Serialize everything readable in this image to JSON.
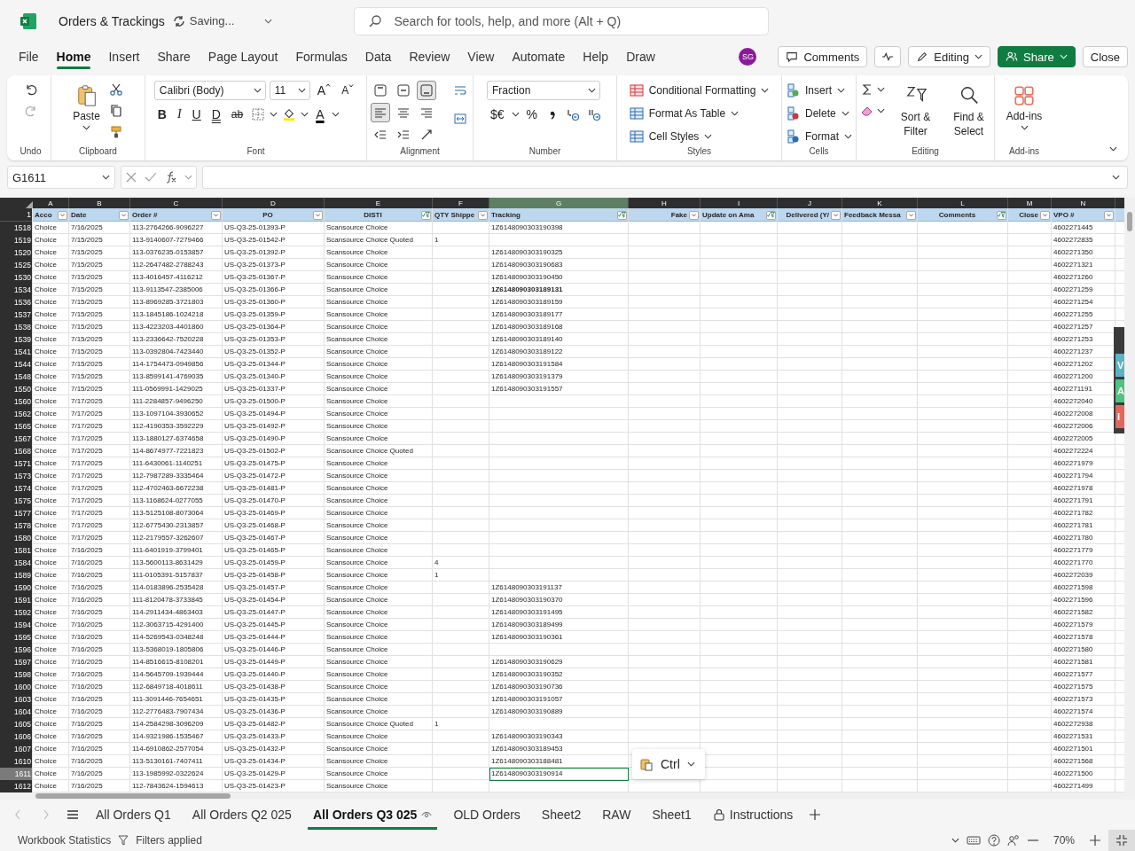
{
  "title_bar": {
    "file_name": "Orders & Trackings",
    "save_status": "Saving...",
    "search_placeholder": "Search for tools, help, and more (Alt + Q)"
  },
  "menu_tabs": [
    {
      "label": "File",
      "selected": false
    },
    {
      "label": "Home",
      "selected": true
    },
    {
      "label": "Insert",
      "selected": false
    },
    {
      "label": "Share",
      "selected": false
    },
    {
      "label": "Page Layout",
      "selected": false
    },
    {
      "label": "Formulas",
      "selected": false
    },
    {
      "label": "Data",
      "selected": false
    },
    {
      "label": "Review",
      "selected": false
    },
    {
      "label": "View",
      "selected": false
    },
    {
      "label": "Automate",
      "selected": false
    },
    {
      "label": "Help",
      "selected": false
    },
    {
      "label": "Draw",
      "selected": false
    }
  ],
  "user_initials": "SG",
  "actions": {
    "comments": "Comments",
    "mode": "Editing",
    "share": "Share",
    "close": "Close"
  },
  "ribbon": {
    "undo": {
      "label": "Undo"
    },
    "clipboard": {
      "paste": "Paste",
      "label": "Clipboard"
    },
    "font": {
      "family": "Calibri (Body)",
      "size": "11",
      "grow": "A",
      "shrink": "A",
      "styles": [
        "B",
        "I",
        "U",
        "D",
        "ab"
      ],
      "color_letter": "A",
      "label": "Font"
    },
    "alignment": {
      "vertical": [
        {
          "selected": false
        },
        {
          "selected": false
        },
        {
          "selected": true
        }
      ],
      "horizontal": [
        {
          "selected": true
        },
        {
          "selected": false
        },
        {
          "selected": false
        }
      ],
      "label": "Alignment"
    },
    "number": {
      "format": "Fraction",
      "currency": "$€",
      "percent": "%",
      "label": "Number"
    },
    "styles": {
      "items": [
        "Conditional Formatting",
        "Format As Table",
        "Cell Styles"
      ],
      "label": "Styles"
    },
    "cells": {
      "items": [
        "Insert",
        "Delete",
        "Format"
      ],
      "label": "Cells"
    },
    "editing": {
      "sort": "Sort & Filter",
      "find": "Find & Select",
      "label": "Editing"
    },
    "addins": {
      "button": "Add-ins",
      "label": "Add-ins"
    }
  },
  "formula_bar": {
    "name_box": "G1611"
  },
  "columns": [
    {
      "letter": "A",
      "header": "Acco",
      "filtered": false,
      "selected": false
    },
    {
      "letter": "B",
      "header": "Date",
      "filtered": false,
      "selected": false
    },
    {
      "letter": "C",
      "header": "Order #",
      "filtered": false,
      "selected": false
    },
    {
      "letter": "D",
      "header": "PO",
      "filtered": false,
      "selected": false
    },
    {
      "letter": "E",
      "header": "DISTI",
      "filtered": true,
      "selected": false
    },
    {
      "letter": "F",
      "header": "QTY Shippe",
      "filtered": false,
      "selected": false
    },
    {
      "letter": "G",
      "header": "Tracking",
      "filtered": true,
      "selected": true
    },
    {
      "letter": "H",
      "header": "Fake",
      "filtered": false,
      "selected": false
    },
    {
      "letter": "I",
      "header": "Update on Ama",
      "filtered": true,
      "selected": false
    },
    {
      "letter": "J",
      "header": "Delivered (Y/",
      "filtered": false,
      "selected": false
    },
    {
      "letter": "K",
      "header": "Feedback Messa",
      "filtered": false,
      "selected": false
    },
    {
      "letter": "L",
      "header": "Comments",
      "filtered": true,
      "selected": false
    },
    {
      "letter": "M",
      "header": "Close",
      "filtered": false,
      "selected": false
    },
    {
      "letter": "N",
      "header": "VPO #",
      "filtered": false,
      "selected": false
    }
  ],
  "header_row_number": "1",
  "rows": [
    {
      "row": "1518",
      "account": "Choice",
      "date": "7/16/2025",
      "order": "113-2764266-9096227",
      "po": "US-Q3-25-01393-P",
      "disti": "Scansource Choice",
      "tracking": "1Z6148090303190398",
      "tracking_bold": false,
      "vpo": "4602271445",
      "selected": false
    },
    {
      "row": "1519",
      "account": "Choice",
      "date": "7/15/2025",
      "order": "113-9140607-7279466",
      "po": "US-Q3-25-01542-P",
      "disti": "Scansource Choice Quoted",
      "qty": "1",
      "vpo": "4602272835",
      "selected": false
    },
    {
      "row": "1520",
      "account": "Choice",
      "date": "7/15/2025",
      "order": "113-0376235-0153857",
      "po": "US-Q3-25-01392-P",
      "disti": "Scansource Choice",
      "tracking": "1Z6148090303190325",
      "tracking_bold": false,
      "vpo": "4602271350",
      "selected": false
    },
    {
      "row": "1525",
      "account": "Choice",
      "date": "7/15/2025",
      "order": "112-2647482-2788243",
      "po": "US-Q3-25-01373-P",
      "disti": "Scansource Choice",
      "tracking": "1Z6148090303190683",
      "tracking_bold": false,
      "vpo": "4602271321",
      "selected": false
    },
    {
      "row": "1530",
      "account": "Choice",
      "date": "7/15/2025",
      "order": "113-4016457-4116212",
      "po": "US-Q3-25-01367-P",
      "disti": "Scansource Choice",
      "tracking": "1Z6148090303190450",
      "tracking_bold": false,
      "vpo": "4602271260",
      "selected": false
    },
    {
      "row": "1534",
      "account": "Choice",
      "date": "7/15/2025",
      "order": "113-9113547-2385006",
      "po": "US-Q3-25-01366-P",
      "disti": "Scansource Choice",
      "tracking": "1Z6148090303189131",
      "tracking_bold": true,
      "vpo": "4602271259",
      "selected": false
    },
    {
      "row": "1536",
      "account": "Choice",
      "date": "7/15/2025",
      "order": "113-8969285-3721803",
      "po": "US-Q3-25-01360-P",
      "disti": "Scansource Choice",
      "tracking": "1Z6148090303189159",
      "tracking_bold": false,
      "vpo": "4602271254",
      "selected": false
    },
    {
      "row": "1537",
      "account": "Choice",
      "date": "7/15/2025",
      "order": "113-1845186-1024218",
      "po": "US-Q3-25-01359-P",
      "disti": "Scansource Choice",
      "tracking": "1Z6148090303189177",
      "tracking_bold": false,
      "vpo": "4602271255",
      "selected": false
    },
    {
      "row": "1538",
      "account": "Choice",
      "date": "7/15/2025",
      "order": "113-4223203-4401860",
      "po": "US-Q3-25-01364-P",
      "disti": "Scansource Choice",
      "tracking": "1Z6148090303189168",
      "tracking_bold": false,
      "vpo": "4602271257",
      "selected": false
    },
    {
      "row": "1539",
      "account": "Choice",
      "date": "7/15/2025",
      "order": "113-2336642-7520228",
      "po": "US-Q3-25-01353-P",
      "disti": "Scansource Choice",
      "tracking": "1Z6148090303189140",
      "tracking_bold": false,
      "vpo": "4602271253",
      "selected": false
    },
    {
      "row": "1541",
      "account": "Choice",
      "date": "7/15/2025",
      "order": "113-0392804-7423440",
      "po": "US-Q3-25-01352-P",
      "disti": "Scansource Choice",
      "tracking": "1Z6148090303189122",
      "tracking_bold": false,
      "vpo": "4602271237",
      "selected": false
    },
    {
      "row": "1544",
      "account": "Choice",
      "date": "7/15/2025",
      "order": "114-1754473-0949856",
      "po": "US-Q3-25-01344-P",
      "disti": "Scansource Choice",
      "tracking": "1Z6148090303191584",
      "tracking_bold": false,
      "vpo": "4602271202",
      "selected": false
    },
    {
      "row": "1548",
      "account": "Choice",
      "date": "7/15/2025",
      "order": "113-8599141-4769035",
      "po": "US-Q3-25-01340-P",
      "disti": "Scansource Choice",
      "tracking": "1Z6148090303191379",
      "tracking_bold": false,
      "vpo": "4602271200",
      "selected": false
    },
    {
      "row": "1550",
      "account": "Choice",
      "date": "7/15/2025",
      "order": "111-0569991-1429025",
      "po": "US-Q3-25-01337-P",
      "disti": "Scansource Choice",
      "tracking": "1Z6148090303191557",
      "tracking_bold": false,
      "vpo": "4602271191",
      "selected": false
    },
    {
      "row": "1560",
      "account": "Choice",
      "date": "7/17/2025",
      "order": "111-2284857-9496250",
      "po": "US-Q3-25-01500-P",
      "disti": "Scansource Choice",
      "vpo": "4602272040",
      "selected": false
    },
    {
      "row": "1562",
      "account": "Choice",
      "date": "7/17/2025",
      "order": "113-1097104-3930652",
      "po": "US-Q3-25-01494-P",
      "disti": "Scansource Choice",
      "vpo": "4602272008",
      "selected": false
    },
    {
      "row": "1565",
      "account": "Choice",
      "date": "7/17/2025",
      "order": "112-4190353-3592229",
      "po": "US-Q3-25-01492-P",
      "disti": "Scansource Choice",
      "vpo": "4602272006",
      "selected": false
    },
    {
      "row": "1567",
      "account": "Choice",
      "date": "7/17/2025",
      "order": "113-1880127-6374658",
      "po": "US-Q3-25-01490-P",
      "disti": "Scansource Choice",
      "vpo": "4602272005",
      "selected": false
    },
    {
      "row": "1568",
      "account": "Choice",
      "date": "7/17/2025",
      "order": "114-8674977-7221823",
      "po": "US-Q3-25-01502-P",
      "disti": "Scansource Choice Quoted",
      "vpo": "4602272224",
      "selected": false
    },
    {
      "row": "1571",
      "account": "Choice",
      "date": "7/17/2025",
      "order": "111-6430061-1140251",
      "po": "US-Q3-25-01475-P",
      "disti": "Scansource Choice",
      "vpo": "4602271979",
      "selected": false
    },
    {
      "row": "1573",
      "account": "Choice",
      "date": "7/17/2025",
      "order": "112-7987289-3335464",
      "po": "US-Q3-25-01472-P",
      "disti": "Scansource Choice",
      "vpo": "4602271794",
      "selected": false
    },
    {
      "row": "1574",
      "account": "Choice",
      "date": "7/17/2025",
      "order": "112-4702463-6672238",
      "po": "US-Q3-25-01481-P",
      "disti": "Scansource Choice",
      "vpo": "4602271978",
      "selected": false
    },
    {
      "row": "1575",
      "account": "Choice",
      "date": "7/17/2025",
      "order": "113-1168624-0277055",
      "po": "US-Q3-25-01470-P",
      "disti": "Scansource Choice",
      "vpo": "4602271791",
      "selected": false
    },
    {
      "row": "1577",
      "account": "Choice",
      "date": "7/17/2025",
      "order": "113-5125108-8073064",
      "po": "US-Q3-25-01469-P",
      "disti": "Scansource Choice",
      "vpo": "4602271782",
      "selected": false
    },
    {
      "row": "1578",
      "account": "Choice",
      "date": "7/17/2025",
      "order": "112-6775430-2313857",
      "po": "US-Q3-25-01468-P",
      "disti": "Scansource Choice",
      "vpo": "4602271781",
      "selected": false
    },
    {
      "row": "1580",
      "account": "Choice",
      "date": "7/17/2025",
      "order": "112-2179557-3262607",
      "po": "US-Q3-25-01467-P",
      "disti": "Scansource Choice",
      "vpo": "4602271780",
      "selected": false
    },
    {
      "row": "1581",
      "account": "Choice",
      "date": "7/16/2025",
      "order": "111-6401919-3799401",
      "po": "US-Q3-25-01465-P",
      "disti": "Scansource Choice",
      "vpo": "4602271779",
      "selected": false
    },
    {
      "row": "1584",
      "account": "Choice",
      "date": "7/16/2025",
      "order": "113-5600113-8631429",
      "po": "US-Q3-25-01459-P",
      "disti": "Scansource Choice",
      "qty": "4",
      "vpo": "4602271770",
      "selected": false
    },
    {
      "row": "1589",
      "account": "Choice",
      "date": "7/16/2025",
      "order": "111-0105391-5157837",
      "po": "US-Q3-25-01458-P",
      "disti": "Scansource Choice",
      "qty": "1",
      "vpo": "4602272039",
      "selected": false
    },
    {
      "row": "1590",
      "account": "Choice",
      "date": "7/16/2025",
      "order": "114-0183896-2535428",
      "po": "US-Q3-25-01457-P",
      "disti": "Scansource Choice",
      "tracking": "1Z6148090303191137",
      "tracking_bold": false,
      "vpo": "4602271598",
      "selected": false
    },
    {
      "row": "1591",
      "account": "Choice",
      "date": "7/16/2025",
      "order": "111-8120478-3733845",
      "po": "US-Q3-25-01454-P",
      "disti": "Scansource Choice",
      "tracking": "1Z6148090303190370",
      "tracking_bold": false,
      "vpo": "4602271596",
      "selected": false
    },
    {
      "row": "1592",
      "account": "Choice",
      "date": "7/16/2025",
      "order": "114-2911434-4863403",
      "po": "US-Q3-25-01447-P",
      "disti": "Scansource Choice",
      "tracking": "1Z6148090303191495",
      "tracking_bold": false,
      "vpo": "4602271582",
      "selected": false
    },
    {
      "row": "1594",
      "account": "Choice",
      "date": "7/16/2025",
      "order": "112-3063715-4291400",
      "po": "US-Q3-25-01445-P",
      "disti": "Scansource Choice",
      "tracking": "1Z6148090303189499",
      "tracking_bold": false,
      "vpo": "4602271579",
      "selected": false
    },
    {
      "row": "1595",
      "account": "Choice",
      "date": "7/16/2025",
      "order": "114-5269543-0348248",
      "po": "US-Q3-25-01444-P",
      "disti": "Scansource Choice",
      "tracking": "1Z6148090303190361",
      "tracking_bold": false,
      "vpo": "4602271578",
      "selected": false
    },
    {
      "row": "1596",
      "account": "Choice",
      "date": "7/16/2025",
      "order": "113-5368019-1805806",
      "po": "US-Q3-25-01446-P",
      "disti": "Scansource Choice",
      "vpo": "4602271580",
      "selected": false
    },
    {
      "row": "1597",
      "account": "Choice",
      "date": "7/16/2025",
      "order": "114-8516615-8108201",
      "po": "US-Q3-25-01449-P",
      "disti": "Scansource Choice",
      "tracking": "1Z6148090303190629",
      "tracking_bold": false,
      "vpo": "4602271581",
      "selected": false
    },
    {
      "row": "1598",
      "account": "Choice",
      "date": "7/16/2025",
      "order": "114-5645709-1939444",
      "po": "US-Q3-25-01440-P",
      "disti": "Scansource Choice",
      "tracking": "1Z6148090303190352",
      "tracking_bold": false,
      "vpo": "4602271577",
      "selected": false
    },
    {
      "row": "1600",
      "account": "Choice",
      "date": "7/16/2025",
      "order": "112-6849718-4018611",
      "po": "US-Q3-25-01438-P",
      "disti": "Scansource Choice",
      "tracking": "1Z6148090303190736",
      "tracking_bold": false,
      "vpo": "4602271575",
      "selected": false
    },
    {
      "row": "1603",
      "account": "Choice",
      "date": "7/16/2025",
      "order": "111-3091446-7654651",
      "po": "US-Q3-25-01435-P",
      "disti": "Scansource Choice",
      "tracking": "1Z6148090303191057",
      "tracking_bold": false,
      "vpo": "4602271573",
      "selected": false
    },
    {
      "row": "1604",
      "account": "Choice",
      "date": "7/16/2025",
      "order": "112-2776483-7907434",
      "po": "US-Q3-25-01436-P",
      "disti": "Scansource Choice",
      "tracking": "1Z6148090303190889",
      "tracking_bold": false,
      "vpo": "4602271574",
      "selected": false
    },
    {
      "row": "1605",
      "account": "Choice",
      "date": "7/16/2025",
      "order": "114-2584298-3096209",
      "po": "US-Q3-25-01482-P",
      "disti": "Scansource Choice Quoted",
      "qty": "1",
      "vpo": "4602272938",
      "selected": false
    },
    {
      "row": "1606",
      "account": "Choice",
      "date": "7/16/2025",
      "order": "114-9321986-1535467",
      "po": "US-Q3-25-01433-P",
      "disti": "Scansource Choice",
      "tracking": "1Z6148090303190343",
      "tracking_bold": false,
      "vpo": "4602271531",
      "selected": false
    },
    {
      "row": "1607",
      "account": "Choice",
      "date": "7/16/2025",
      "order": "114-6910862-2577054",
      "po": "US-Q3-25-01432-P",
      "disti": "Scansource Choice",
      "tracking": "1Z6148090303189453",
      "tracking_bold": false,
      "vpo": "4602271501",
      "selected": false
    },
    {
      "row": "1610",
      "account": "Choice",
      "date": "7/16/2025",
      "order": "113-5130161-7407411",
      "po": "US-Q3-25-01434-P",
      "disti": "Scansource Choice",
      "tracking": "1Z6148090303188481",
      "tracking_bold": false,
      "vpo": "4602271568",
      "selected": false
    },
    {
      "row": "1611",
      "account": "Choice",
      "date": "7/16/2025",
      "order": "113-1985992-0322624",
      "po": "US-Q3-25-01429-P",
      "disti": "Scansource Choice",
      "tracking": "1Z6148090303190914",
      "tracking_bold": false,
      "vpo": "4602271500",
      "selected": true
    },
    {
      "row": "1612",
      "account": "Choice",
      "date": "7/16/2025",
      "order": "112-7843624-1594613",
      "po": "US-Q3-25-01423-P",
      "disti": "Scansource Choice",
      "vpo": "4602271499",
      "selected": false
    }
  ],
  "paste_popup": {
    "label": "Ctrl"
  },
  "side_panel": [
    "V",
    "A",
    "I"
  ],
  "sheet_tabs": [
    {
      "label": "All Orders Q1",
      "kind": "plain",
      "selected": false
    },
    {
      "label": "All Orders Q2 025",
      "kind": "plain",
      "selected": false
    },
    {
      "label": "All Orders Q3 025",
      "kind": "watched",
      "selected": true
    },
    {
      "label": "OLD Orders",
      "kind": "plain",
      "selected": false
    },
    {
      "label": "Sheet2",
      "kind": "plain",
      "selected": false
    },
    {
      "label": "RAW",
      "kind": "plain",
      "selected": false
    },
    {
      "label": "Sheet1",
      "kind": "plain",
      "selected": false
    },
    {
      "label": "Instructions",
      "kind": "locked",
      "selected": false
    }
  ],
  "status_bar": {
    "statistics": "Workbook Statistics",
    "filters": "Filters applied",
    "zoom": "70%"
  }
}
